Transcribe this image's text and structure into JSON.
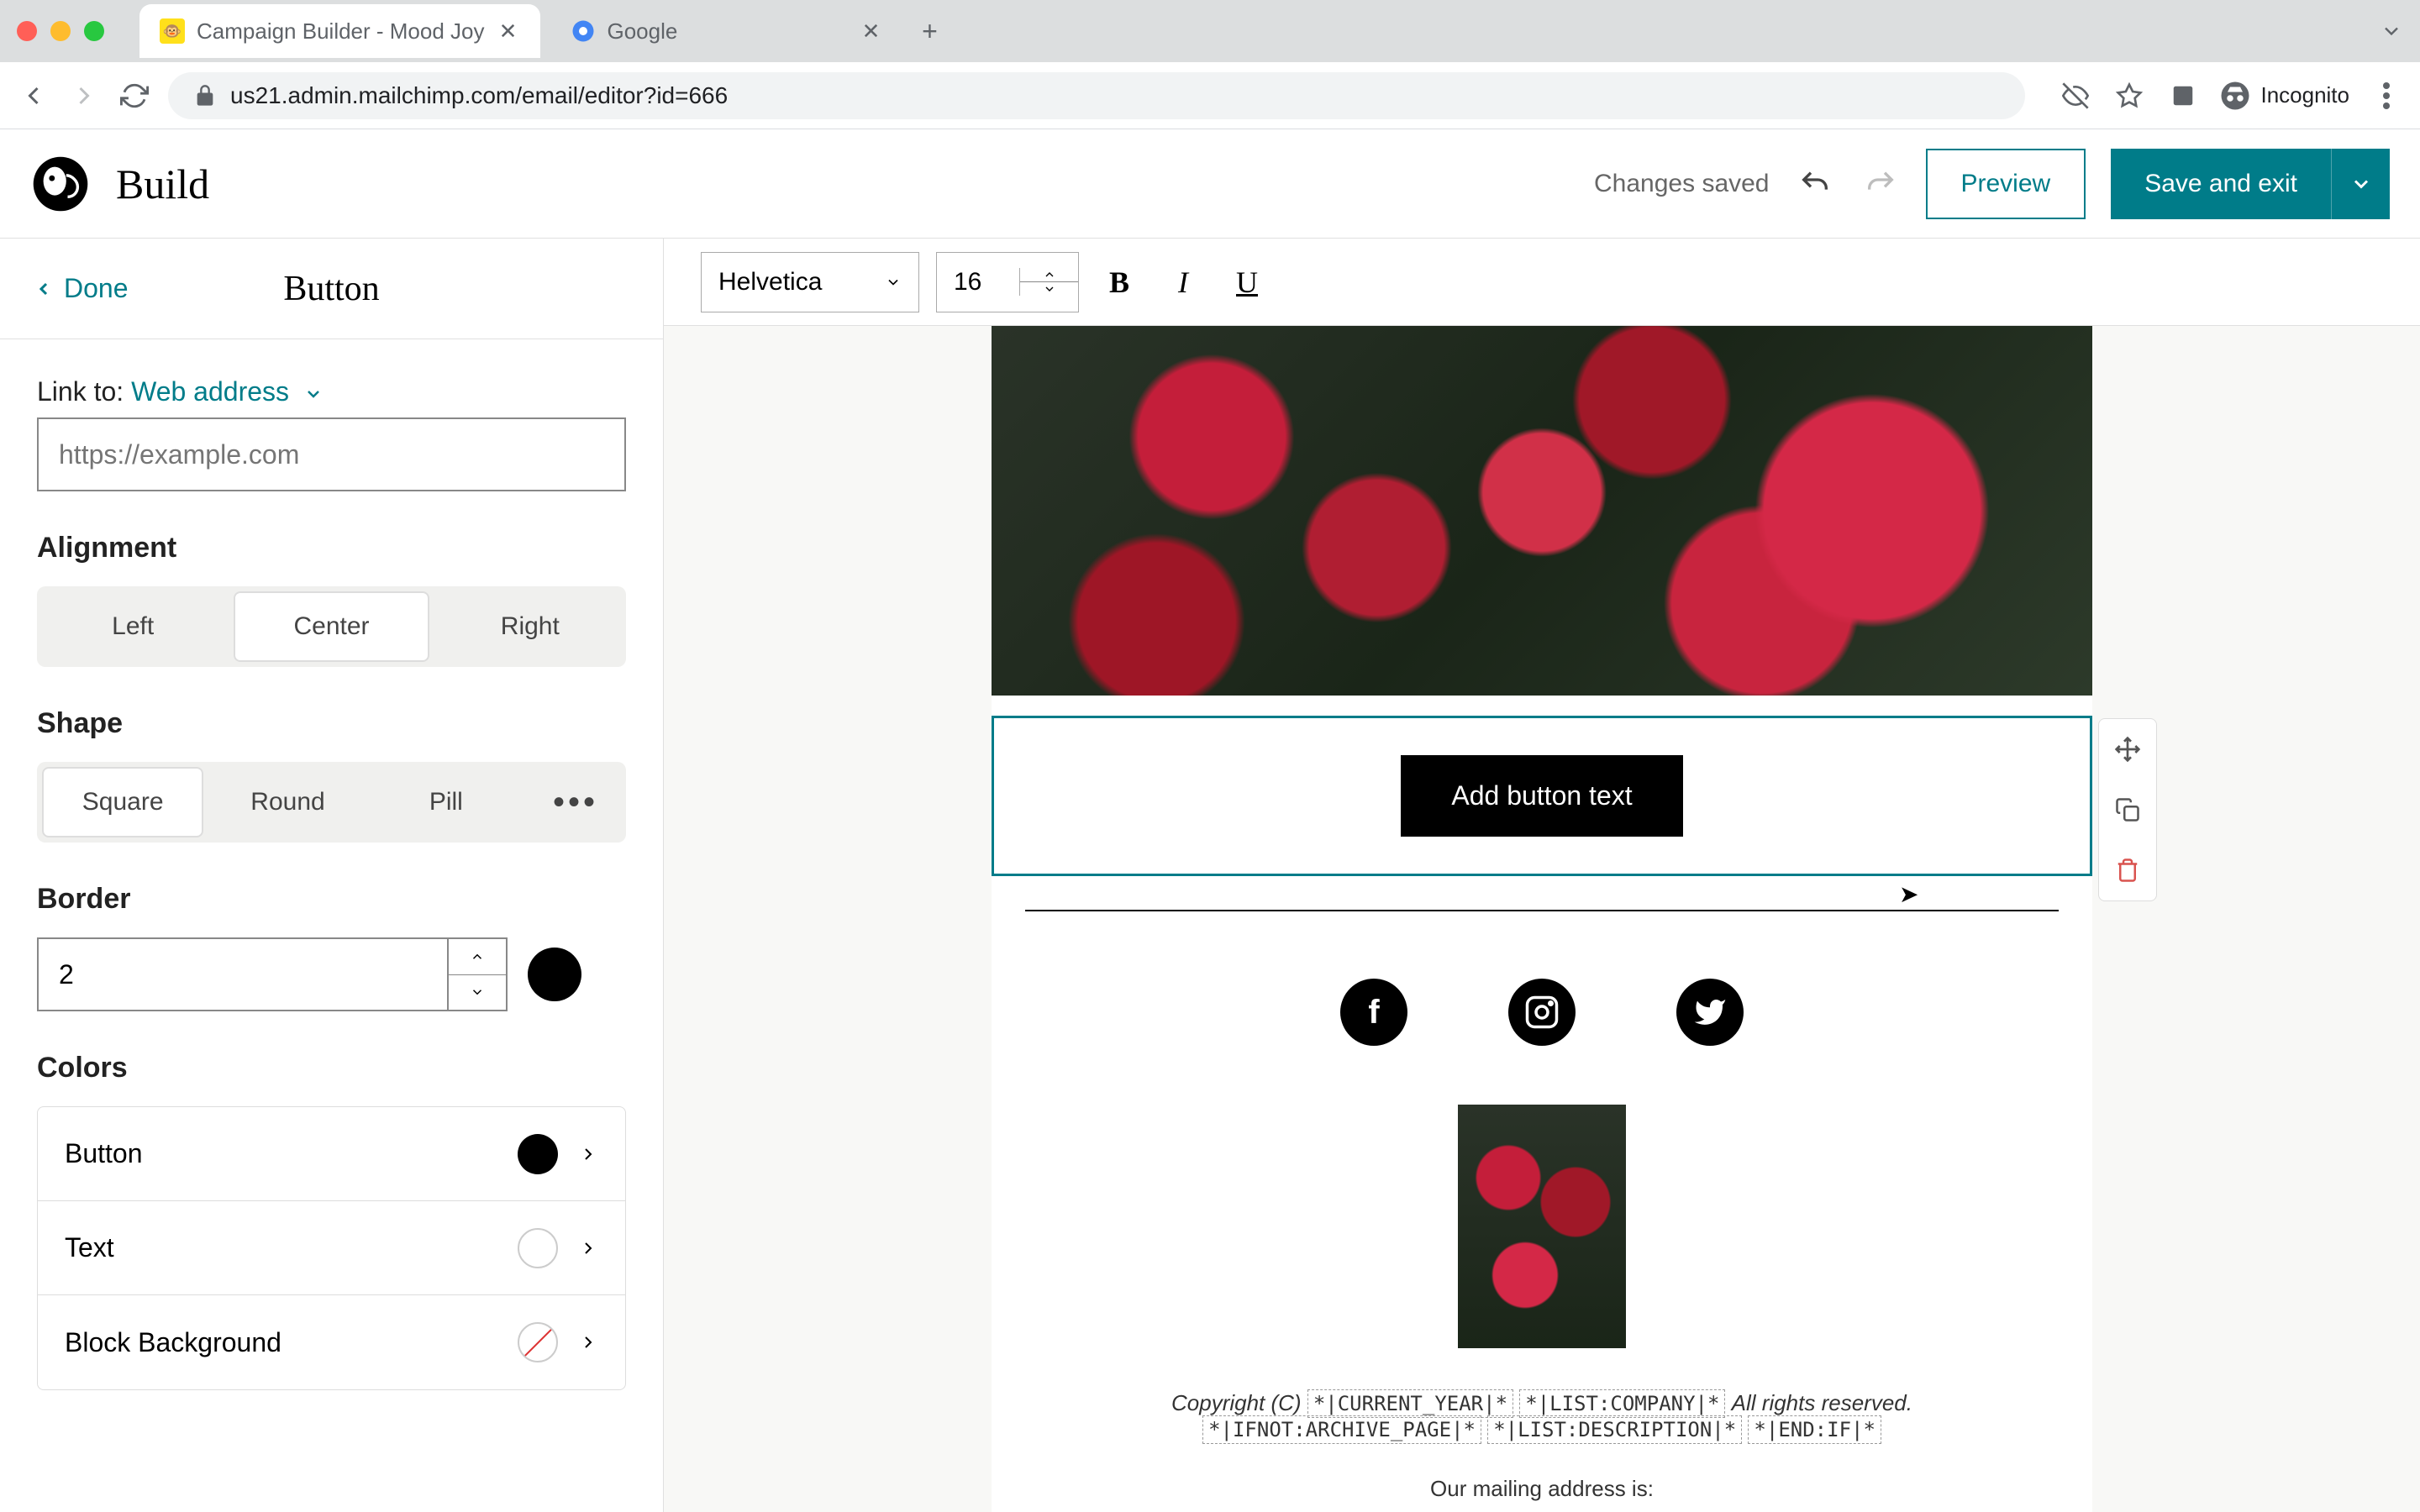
{
  "browser": {
    "tabs": [
      {
        "title": "Campaign Builder - Mood Joy",
        "active": true
      },
      {
        "title": "Google",
        "active": false
      }
    ],
    "url": "us21.admin.mailchimp.com/email/editor?id=666",
    "incognito_label": "Incognito"
  },
  "header": {
    "app_title": "Build",
    "status": "Changes saved",
    "preview": "Preview",
    "save_exit": "Save and exit"
  },
  "sidebar": {
    "done": "Done",
    "panel_title": "Button",
    "link_to_label": "Link to:",
    "link_type": "Web address",
    "url_placeholder": "https://example.com",
    "alignment_label": "Alignment",
    "alignment": [
      "Left",
      "Center",
      "Right"
    ],
    "alignment_active": "Center",
    "shape_label": "Shape",
    "shape": [
      "Square",
      "Round",
      "Pill"
    ],
    "shape_active": "Square",
    "border_label": "Border",
    "border_value": "2",
    "colors_label": "Colors",
    "colors": {
      "button": "Button",
      "text": "Text",
      "block_bg": "Block Background"
    }
  },
  "toolbar": {
    "font": "Helvetica",
    "font_size": "16"
  },
  "canvas": {
    "button_text": "Add button text",
    "footer_copyright_prefix": "Copyright (C) ",
    "footer_copyright_suffix": " All rights reserved.",
    "merge_tags": {
      "year": "*|CURRENT_YEAR|*",
      "company": "*|LIST:COMPANY|*",
      "ifnot": "*|IFNOT:ARCHIVE_PAGE|*",
      "desc": "*|LIST:DESCRIPTION|*",
      "endif": "*|END:IF|*"
    },
    "mailing_label": "Our mailing address is:"
  }
}
